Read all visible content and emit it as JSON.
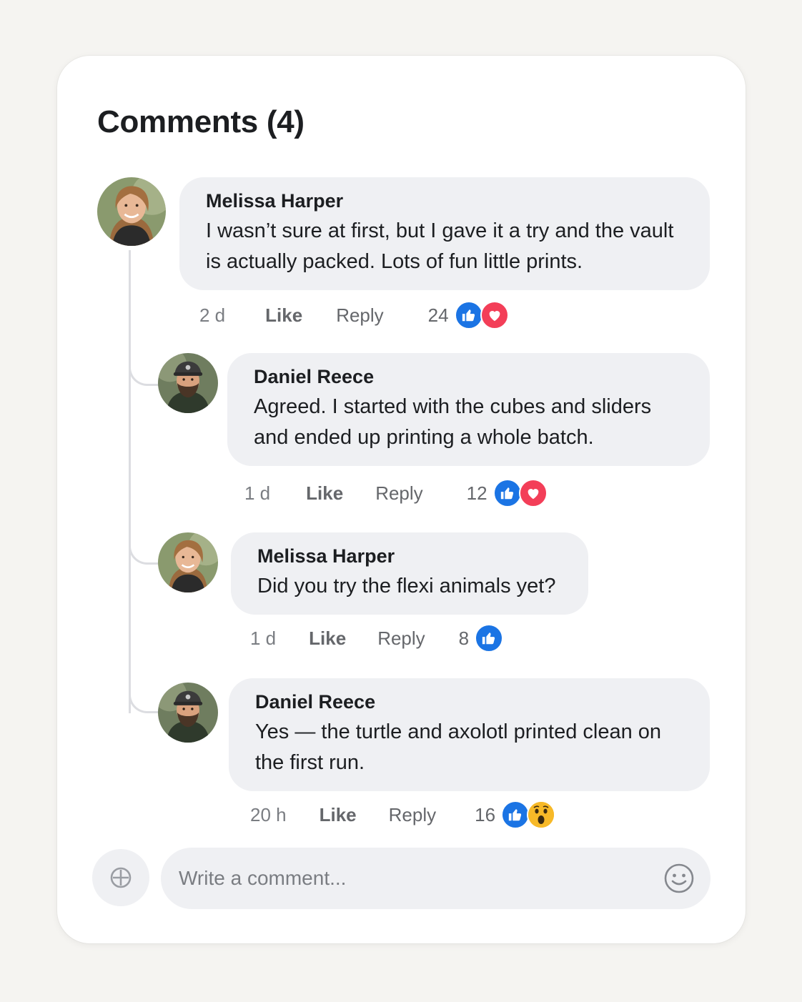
{
  "header": {
    "title": "Comments (4)"
  },
  "comments": [
    {
      "author": "Melissa Harper",
      "text": "I wasn’t sure at first, but I gave it a try and the vault is actually packed. Lots of fun little prints.",
      "time": "2 d",
      "like_label": "Like",
      "reply_label": "Reply",
      "reaction_count": "24",
      "reactions": [
        "like",
        "love"
      ]
    },
    {
      "author": "Daniel Reece",
      "text": "Agreed. I started with the cubes and sliders and ended up printing a whole batch.",
      "time": "1 d",
      "like_label": "Like",
      "reply_label": "Reply",
      "reaction_count": "12",
      "reactions": [
        "like",
        "love"
      ]
    },
    {
      "author": "Melissa Harper",
      "text": "Did you try the flexi animals yet?",
      "time": "1 d",
      "like_label": "Like",
      "reply_label": "Reply",
      "reaction_count": "8",
      "reactions": [
        "like"
      ]
    },
    {
      "author": "Daniel Reece",
      "text": "Yes — the turtle and axolotl printed clean on the first run.",
      "time": "20 h",
      "like_label": "Like",
      "reply_label": "Reply",
      "reaction_count": "16",
      "reactions": [
        "like",
        "wow"
      ]
    }
  ],
  "composer": {
    "placeholder": "Write a comment...",
    "attach_icon": "attach-icon",
    "emoji_icon": "smiley-icon"
  },
  "colors": {
    "like": "#1b74e4",
    "love": "#f33e58",
    "wow": "#f7b928",
    "bubble": "#eff0f3"
  }
}
